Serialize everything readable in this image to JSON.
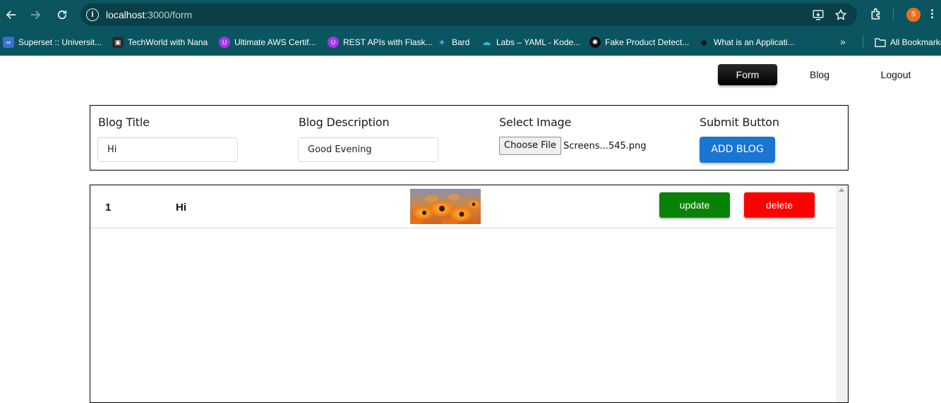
{
  "browser": {
    "url_host": "localhost",
    "url_rest": ":3000/form",
    "profile_initial": "S",
    "bookmarks": [
      {
        "label": "Superset :: Universit...",
        "icon": "superset-icon",
        "color": "#3b6fd6"
      },
      {
        "label": "TechWorld with Nana",
        "icon": "techworld-icon",
        "color": "#2b2b2b"
      },
      {
        "label": "Ultimate AWS Certif...",
        "icon": "udemy-icon",
        "color": "#a435f0"
      },
      {
        "label": "REST APIs with Flask...",
        "icon": "udemy-icon",
        "color": "#a435f0"
      },
      {
        "label": "Bard",
        "icon": "bard-sparkle-icon",
        "color": "#6d8ff0"
      },
      {
        "label": "Labs – YAML - Kode...",
        "icon": "kodekloud-icon",
        "color": "#2fb7d6"
      },
      {
        "label": "Fake Product Detect...",
        "icon": "chatgpt-icon",
        "color": "#111111"
      },
      {
        "label": "What is an Applicati...",
        "icon": "site-icon",
        "color": "#111111"
      }
    ],
    "all_bookmarks": "All Bookmarks"
  },
  "nav": {
    "form": "Form",
    "blog": "Blog",
    "logout": "Logout"
  },
  "form": {
    "title_label": "Blog Title",
    "title_value": "Hi",
    "desc_label": "Blog Description",
    "desc_value": "Good Evening",
    "image_label": "Select Image",
    "choose_file": "Choose File",
    "file_name": "Screens...545.png",
    "submit_label": "Submit Button",
    "add_button": "ADD BLOG"
  },
  "table": {
    "rows": [
      {
        "id": "1",
        "title": "Hi",
        "image": "orange-flowers",
        "update": "update",
        "delete": "delete"
      }
    ]
  },
  "colors": {
    "chrome": "#0b5560",
    "primary": "#1976d2",
    "update": "#078207",
    "delete": "#ff0000"
  }
}
